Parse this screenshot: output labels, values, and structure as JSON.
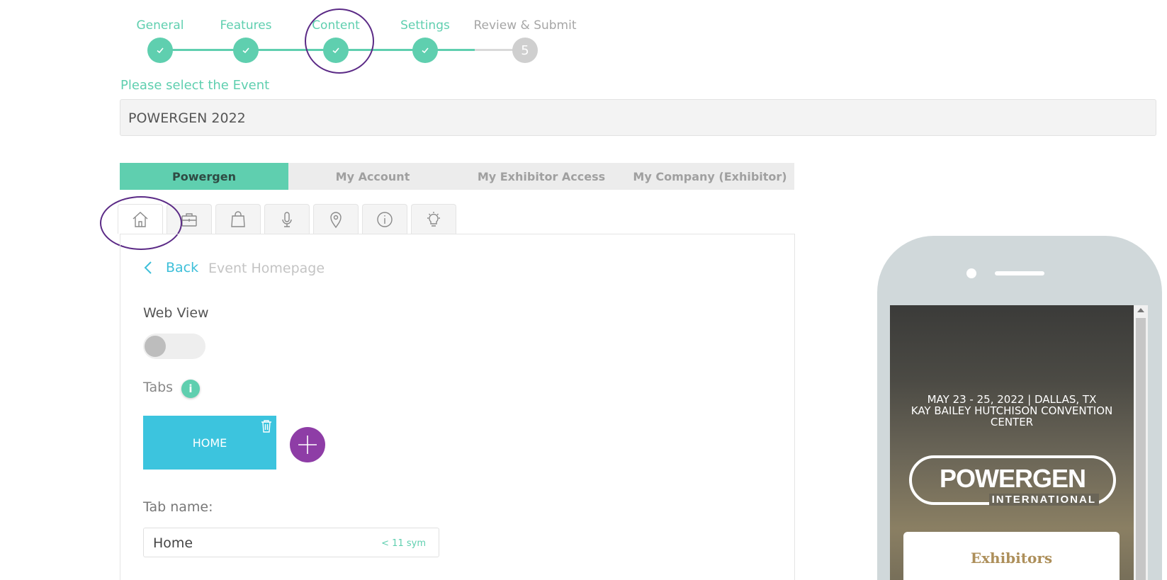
{
  "stepper": {
    "steps": [
      {
        "label": "General",
        "state": "done"
      },
      {
        "label": "Features",
        "state": "done"
      },
      {
        "label": "Content",
        "state": "done"
      },
      {
        "label": "Settings",
        "state": "done"
      },
      {
        "label": "Review & Submit",
        "state": "todo",
        "number": "5"
      }
    ]
  },
  "event_select": {
    "label": "Please select the Event",
    "value": "POWERGEN 2022"
  },
  "main_tabs": [
    {
      "label": "Powergen",
      "active": true
    },
    {
      "label": "My Account",
      "active": false
    },
    {
      "label": "My Exhibitor Access",
      "active": false
    },
    {
      "label": "My Company (Exhibitor)",
      "active": false
    }
  ],
  "icon_tabs": [
    "home-icon",
    "briefcase-icon",
    "shopping-bag-icon",
    "microphone-icon",
    "map-pin-icon",
    "info-icon",
    "lightbulb-icon"
  ],
  "content": {
    "back_label": "Back",
    "breadcrumb": "Event Homepage",
    "web_view_label": "Web View",
    "web_view_enabled": false,
    "tabs_label": "Tabs",
    "info_badge": "i",
    "tab_card_label": "HOME",
    "tab_name_label": "Tab name:",
    "tab_name_value": "Home",
    "tab_name_hint": "< 11 sym"
  },
  "phone_preview": {
    "date_line1": "MAY 23 - 25, 2022 | DALLAS, TX",
    "date_line2": "KAY BAILEY HUTCHISON CONVENTION",
    "date_line3": "CENTER",
    "logo_main": "POWERGEN",
    "logo_sub": "INTERNATIONAL",
    "card_label": "Exhibitors"
  },
  "colors": {
    "accent_green": "#5fcfaf",
    "accent_blue": "#3cc4de",
    "accent_purple": "#8e3da6",
    "annotation_ring": "#5b2a86",
    "exhibitors_gold": "#ad8f5a"
  }
}
